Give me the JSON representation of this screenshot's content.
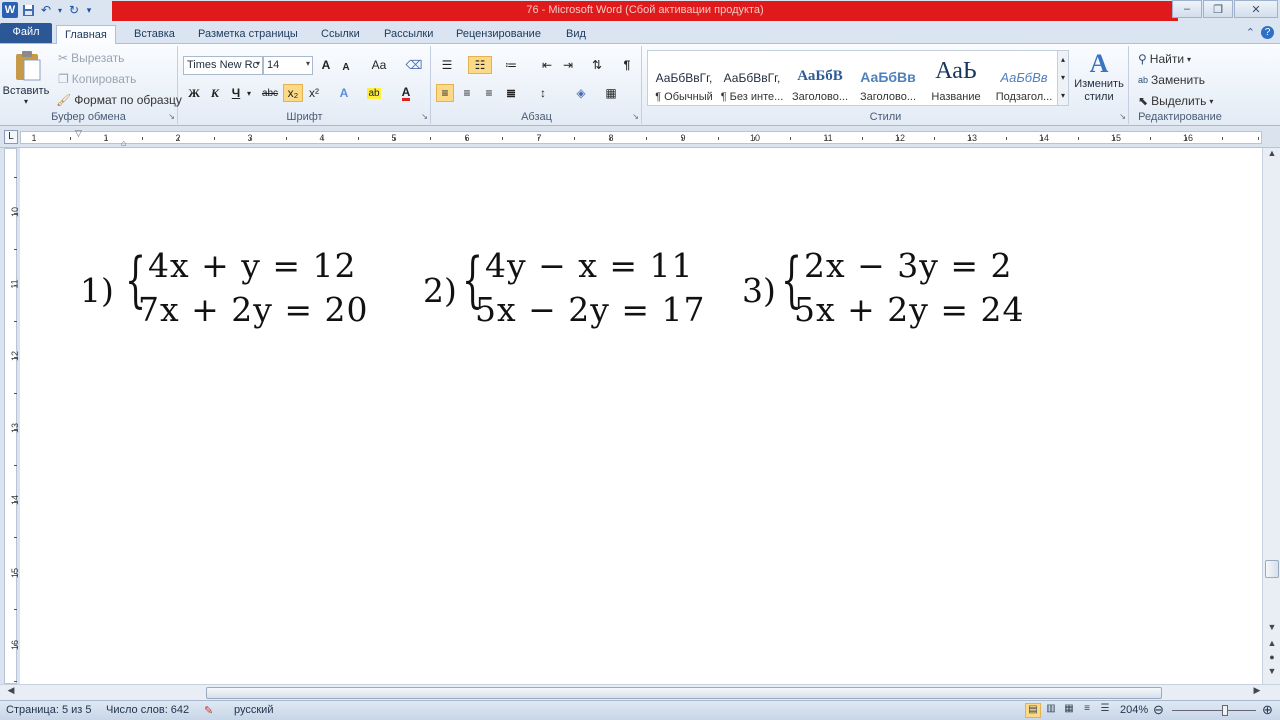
{
  "window": {
    "title": "76  -  Microsoft Word (Сбой активации продукта)",
    "controls": [
      "‒",
      "❐",
      "✕"
    ]
  },
  "qat": {
    "icons": [
      "word-logo",
      "save-icon",
      "undo-icon",
      "redo-icon",
      "customize-icon"
    ],
    "logo": "W"
  },
  "tabs": [
    {
      "label": "Файл"
    },
    {
      "label": "Главная"
    },
    {
      "label": "Вставка"
    },
    {
      "label": "Разметка страницы"
    },
    {
      "label": "Ссылки"
    },
    {
      "label": "Рассылки"
    },
    {
      "label": "Рецензирование"
    },
    {
      "label": "Вид"
    }
  ],
  "ribbon": {
    "clipboard": {
      "label": "Буфер обмена",
      "paste": "Вставить",
      "cut": "Вырезать",
      "copy": "Копировать",
      "format_painter": "Формат по образцу"
    },
    "font": {
      "label": "Шрифт",
      "font_name": "Times New Rc",
      "font_size": "14",
      "bold": "Ж",
      "italic": "К",
      "underline": "Ч",
      "strike": "abc",
      "subscript": "x₂",
      "superscript": "x²",
      "grow": "A",
      "shrink": "A",
      "case": "Aa"
    },
    "paragraph": {
      "label": "Абзац"
    },
    "styles": {
      "label": "Стили",
      "items": [
        {
          "sample": "АаБбВвГг,",
          "name": "¶ Обычный"
        },
        {
          "sample": "АаБбВвГг,",
          "name": "¶ Без инте..."
        },
        {
          "sample": "АаБбВ",
          "name": "Заголово..."
        },
        {
          "sample": "АаБбВв",
          "name": "Заголово..."
        },
        {
          "sample": "АаЬ",
          "name": "Название"
        },
        {
          "sample": "АаБбВв",
          "name": "Подзагол..."
        }
      ],
      "change": "Изменить стили"
    },
    "editing": {
      "label": "Редактирование",
      "find": "Найти",
      "replace": "Заменить",
      "select": "Выделить"
    }
  },
  "ruler": {
    "h_numbers": [
      "1",
      "1",
      "2",
      "3",
      "4",
      "5",
      "6",
      "7",
      "8",
      "9",
      "10",
      "11",
      "12",
      "13",
      "14",
      "15",
      "16"
    ],
    "v_numbers": [
      "10",
      "11",
      "12",
      "13",
      "14",
      "15",
      "16"
    ]
  },
  "document": {
    "systems": [
      {
        "number": "1)",
        "line1": "4x + y = 12",
        "line2": "7x + 2y = 20"
      },
      {
        "number": "2)",
        "line1": "4y − x = 11",
        "line2": "5x − 2y = 17"
      },
      {
        "number": "3)",
        "line1": "2x − 3y = 2",
        "line2": "5x + 2y = 24"
      }
    ]
  },
  "status": {
    "page": "Страница: 5 из 5",
    "words": "Число слов: 642",
    "language": "русский",
    "zoom": "204%"
  }
}
